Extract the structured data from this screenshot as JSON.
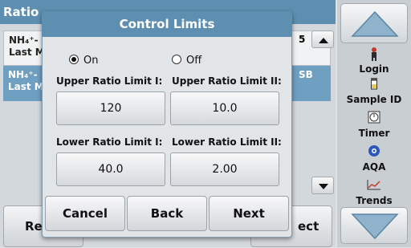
{
  "background": {
    "header_title": "Ratio",
    "row1": {
      "line1": "NH₄⁺-",
      "line2": "Last M",
      "value": "5"
    },
    "row2": {
      "line1": "NH₄⁺-",
      "line2": "Last M",
      "value": "SB"
    },
    "bottom_left_label": "Re",
    "bottom_right_label": "ect"
  },
  "toolbar": {
    "items": [
      {
        "label": "Login",
        "icon": "person-icon"
      },
      {
        "label": "Sample ID",
        "icon": "sample-vial-icon"
      },
      {
        "label": "Timer",
        "icon": "timer-icon"
      },
      {
        "label": "AQA",
        "icon": "aqa-icon"
      },
      {
        "label": "Trends",
        "icon": "trends-icon"
      }
    ]
  },
  "dialog": {
    "title": "Control Limits",
    "on_label": "On",
    "off_label": "Off",
    "selected": "On",
    "upper_limit_1_label": "Upper Ratio Limit I:",
    "upper_limit_2_label": "Upper Ratio Limit II:",
    "upper_limit_1_value": "120",
    "upper_limit_2_value": "10.0",
    "lower_limit_1_label": "Lower Ratio Limit I:",
    "lower_limit_2_label": "Lower Ratio Limit II:",
    "lower_limit_1_value": "40.0",
    "lower_limit_2_value": "2.00",
    "cancel_label": "Cancel",
    "back_label": "Back",
    "next_label": "Next"
  }
}
